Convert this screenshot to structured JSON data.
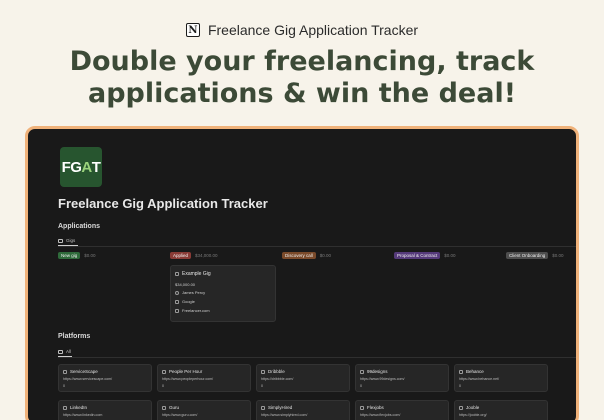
{
  "brand": {
    "icon": "notion-logo-icon",
    "title": "Freelance Gig Application Tracker"
  },
  "headline": {
    "line1": "Double your freelancing, track",
    "line2": "applications & win the deal!"
  },
  "app": {
    "logo_text_1": "FG",
    "logo_text_2": "A",
    "logo_text_3": "T",
    "title": "Freelance Gig Application Tracker"
  },
  "applications": {
    "title": "Applications",
    "view_tab": "Gigs",
    "columns": [
      {
        "label": "New gig",
        "sum": "$0.00",
        "color": "#2f6b3b"
      },
      {
        "label": "Applied",
        "sum": "$34,000.00",
        "color": "#8a3b36"
      },
      {
        "label": "Discovery call",
        "sum": "$0.00",
        "color": "#7a4a2a"
      },
      {
        "label": "Proposal & Contract",
        "sum": "$0.00",
        "color": "#553a7a"
      },
      {
        "label": "Client Onboarding",
        "sum": "$0.00",
        "color": "#4d4d4d"
      }
    ],
    "card": {
      "title": "Example Gig",
      "amount": "$34,000.00",
      "person": "James Percy",
      "company": "Google",
      "platform": "Freelancer.com"
    }
  },
  "platforms": {
    "title": "Platforms",
    "view_tab": "All",
    "items": [
      {
        "name": "ServiceScape",
        "url": "https://www.servicescape.com/",
        "count": "0"
      },
      {
        "name": "People Per Hour",
        "url": "https://www.peopleperhour.com/",
        "count": "0"
      },
      {
        "name": "Dribbble",
        "url": "https://dribbble.com/",
        "count": "0"
      },
      {
        "name": "99designs",
        "url": "https://www.99designs.com/",
        "count": "0"
      },
      {
        "name": "Behance",
        "url": "https://www.behance.net/",
        "count": "0"
      },
      {
        "name": "LinkedIn",
        "url": "https://www.linkedin.com",
        "count": ""
      },
      {
        "name": "Guru",
        "url": "https://www.guru.com/",
        "count": ""
      },
      {
        "name": "SimplyHired",
        "url": "https://www.simplyhired.com/",
        "count": ""
      },
      {
        "name": "Flexjobs",
        "url": "https://www.flexjobs.com/",
        "count": ""
      },
      {
        "name": "Jooble",
        "url": "https://jooble.org/",
        "count": ""
      }
    ]
  }
}
